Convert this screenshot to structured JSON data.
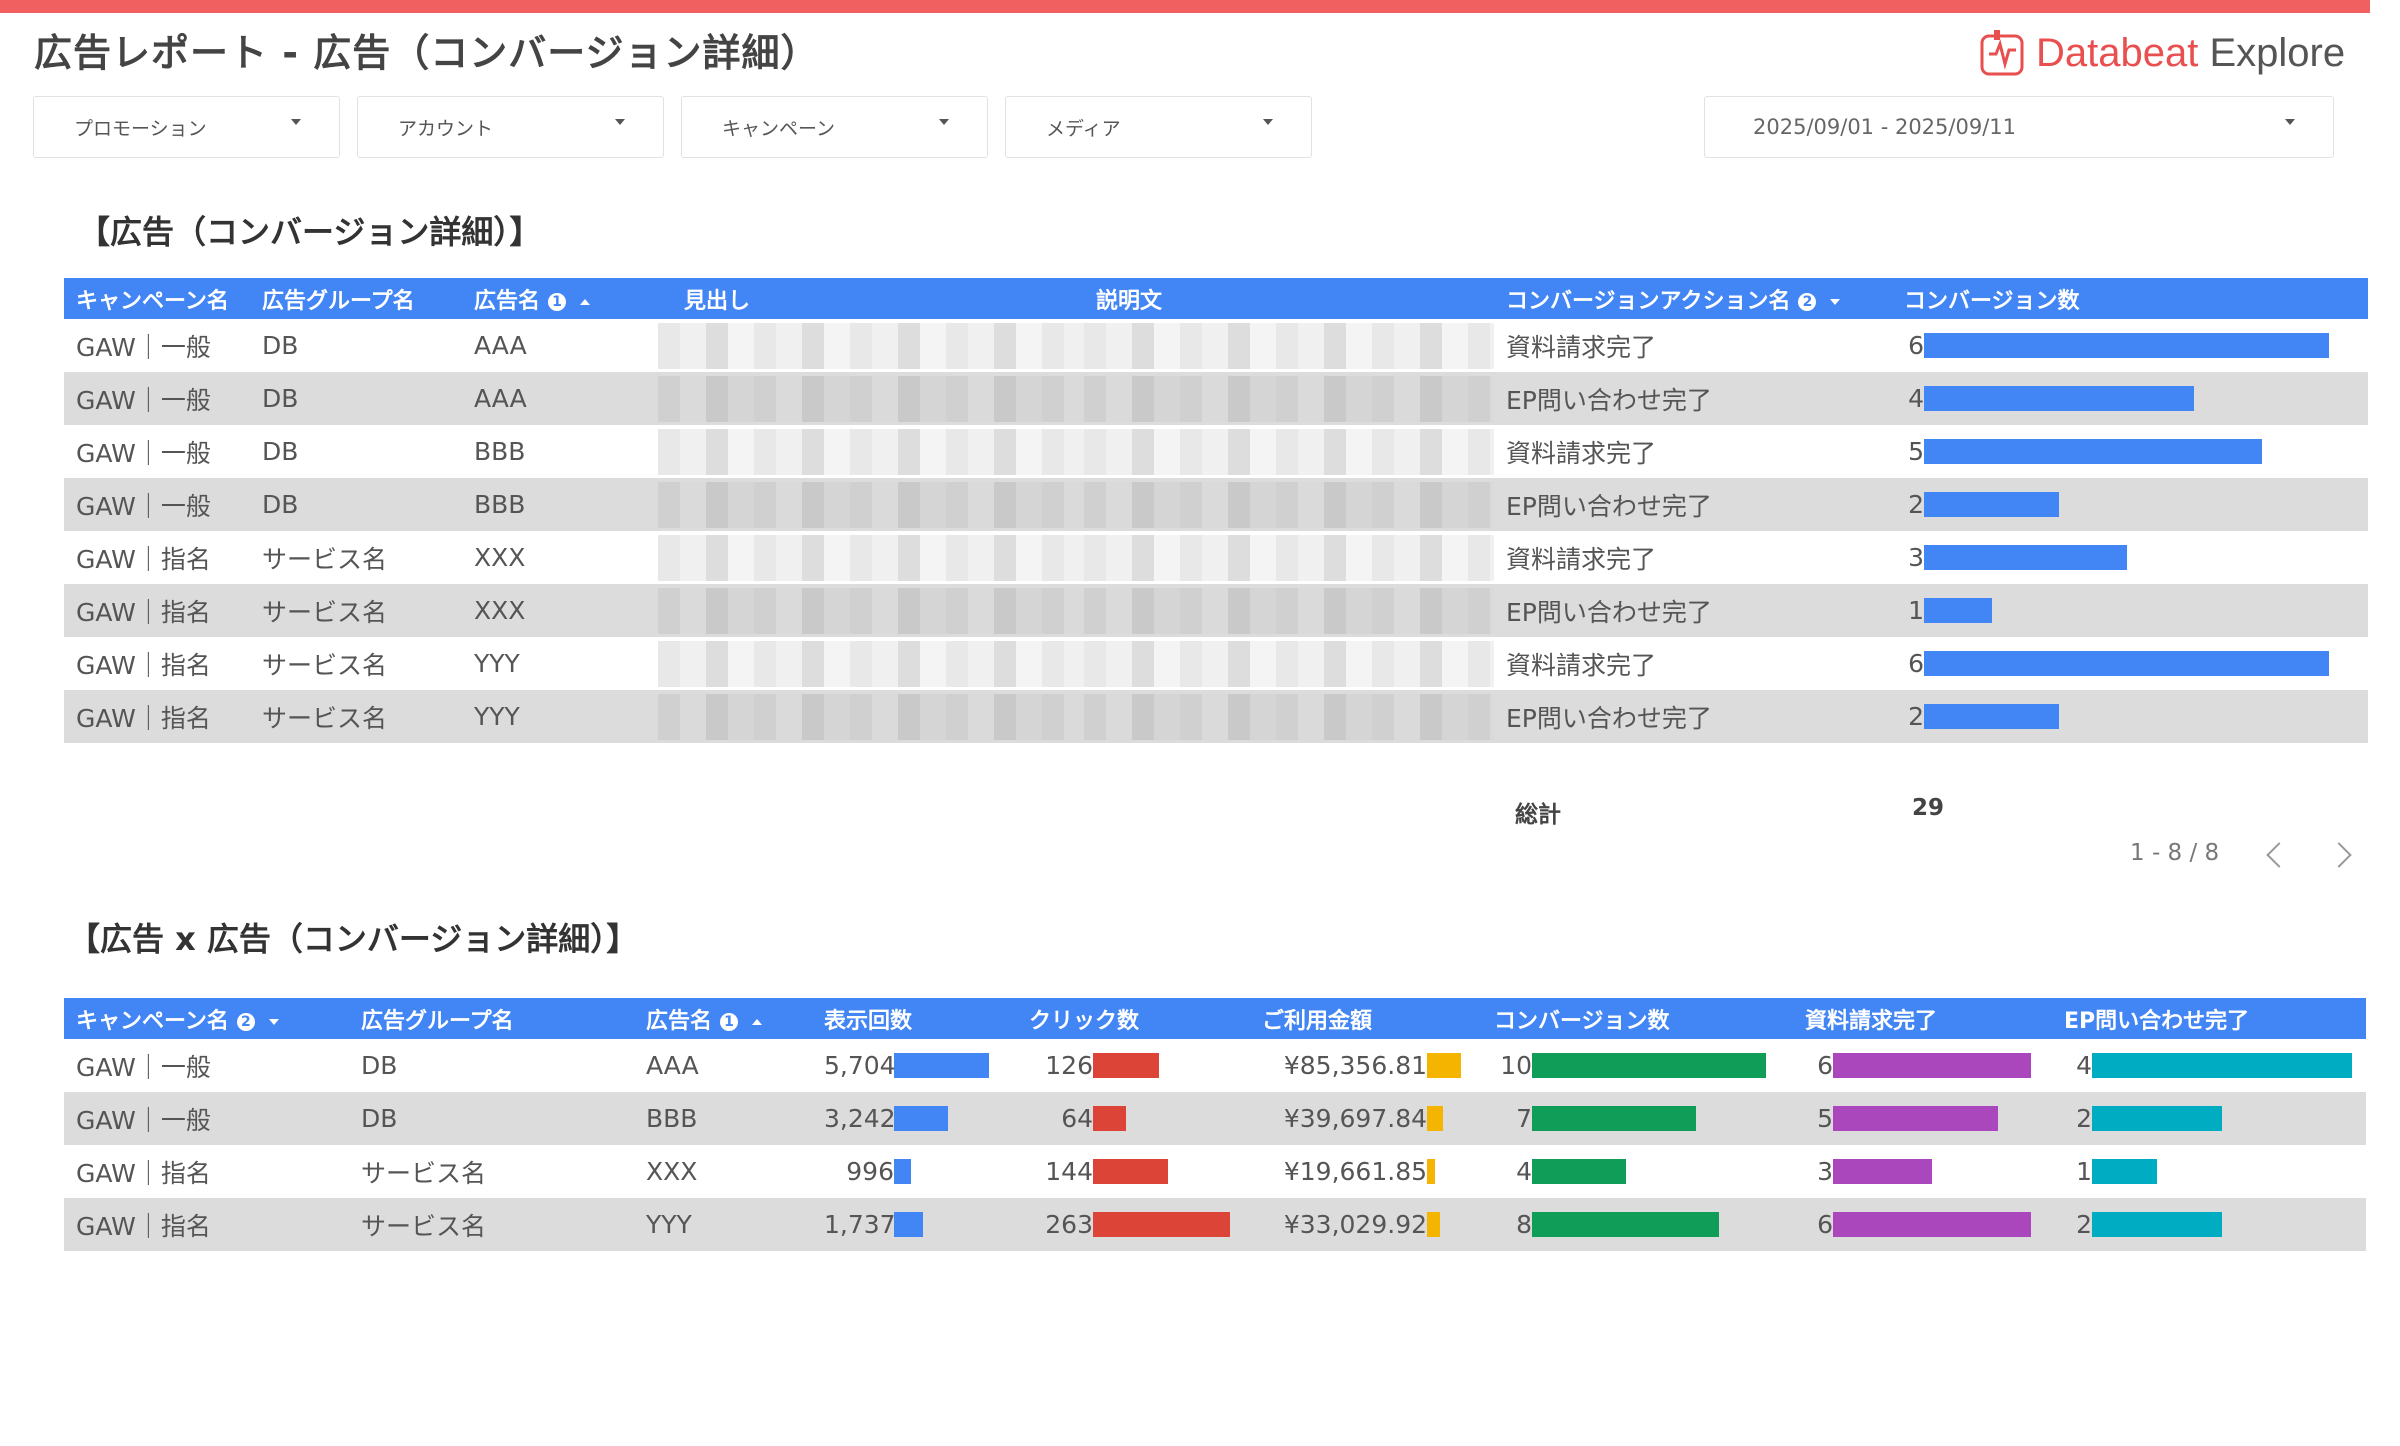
{
  "page_title": "広告レポート - 広告（コンバージョン詳細）",
  "brand": {
    "name": "Databeat",
    "suffix": " Explore",
    "color": "#e94f4f"
  },
  "filters": {
    "promotion": "プロモーション",
    "account": "アカウント",
    "campaign": "キャンペーン",
    "media": "メディア",
    "date_range": "2025/09/01 - 2025/09/11"
  },
  "table1": {
    "title": "【広告（コンバージョン詳細）】",
    "headers": [
      "キャンペーン名",
      "広告グループ名",
      "広告名",
      "見出し",
      "説明文",
      "コンバージョンアクション名",
      "コンバージョン数"
    ],
    "sort_badge_ad": "1",
    "sort_badge_action": "2",
    "max_value": 6,
    "rows": [
      {
        "campaign": "GAW｜一般",
        "adgroup": "DB",
        "ad": "AAA",
        "action": "資料請求完了",
        "conversions": 6
      },
      {
        "campaign": "GAW｜一般",
        "adgroup": "DB",
        "ad": "AAA",
        "action": "EP問い合わせ完了",
        "conversions": 4
      },
      {
        "campaign": "GAW｜一般",
        "adgroup": "DB",
        "ad": "BBB",
        "action": "資料請求完了",
        "conversions": 5
      },
      {
        "campaign": "GAW｜一般",
        "adgroup": "DB",
        "ad": "BBB",
        "action": "EP問い合わせ完了",
        "conversions": 2
      },
      {
        "campaign": "GAW｜指名",
        "adgroup": "サービス名",
        "ad": "XXX",
        "action": "資料請求完了",
        "conversions": 3
      },
      {
        "campaign": "GAW｜指名",
        "adgroup": "サービス名",
        "ad": "XXX",
        "action": "EP問い合わせ完了",
        "conversions": 1
      },
      {
        "campaign": "GAW｜指名",
        "adgroup": "サービス名",
        "ad": "YYY",
        "action": "資料請求完了",
        "conversions": 6
      },
      {
        "campaign": "GAW｜指名",
        "adgroup": "サービス名",
        "ad": "YYY",
        "action": "EP問い合わせ完了",
        "conversions": 2
      }
    ],
    "total_label": "総計",
    "total_value": "29",
    "pager": "1 - 8 / 8",
    "bar_color": "#4285f4"
  },
  "table2": {
    "title": "【広告 x 広告（コンバージョン詳細）】",
    "headers": [
      "キャンペーン名",
      "広告グループ名",
      "広告名",
      "表示回数",
      "クリック数",
      "ご利用金額",
      "コンバージョン数",
      "資料請求完了",
      "EP問い合わせ完了"
    ],
    "sort_badge_campaign": "2",
    "sort_badge_ad": "1",
    "colors": {
      "impressions": "#4285f4",
      "clicks": "#db4437",
      "cost": "#f4b400",
      "conversions": "#0f9d58",
      "request": "#ab47bc",
      "inquiry": "#00acc1"
    },
    "max": {
      "impressions": 5704,
      "clicks": 263,
      "cost": 85356.81,
      "conversions": 10,
      "request": 6,
      "inquiry": 4
    },
    "rows": [
      {
        "campaign": "GAW｜一般",
        "adgroup": "DB",
        "ad": "AAA",
        "impressions": 5704,
        "impressions_label": "5,704",
        "clicks": 126,
        "clicks_label": "126",
        "cost": 85356.81,
        "cost_label": "¥85,356.81",
        "conversions": 10,
        "conversions_label": "10",
        "request": 6,
        "request_label": "6",
        "inquiry": 4,
        "inquiry_label": "4"
      },
      {
        "campaign": "GAW｜一般",
        "adgroup": "DB",
        "ad": "BBB",
        "impressions": 3242,
        "impressions_label": "3,242",
        "clicks": 64,
        "clicks_label": "64",
        "cost": 39697.84,
        "cost_label": "¥39,697.84",
        "conversions": 7,
        "conversions_label": "7",
        "request": 5,
        "request_label": "5",
        "inquiry": 2,
        "inquiry_label": "2"
      },
      {
        "campaign": "GAW｜指名",
        "adgroup": "サービス名",
        "ad": "XXX",
        "impressions": 996,
        "impressions_label": "996",
        "clicks": 144,
        "clicks_label": "144",
        "cost": 19661.85,
        "cost_label": "¥19,661.85",
        "conversions": 4,
        "conversions_label": "4",
        "request": 3,
        "request_label": "3",
        "inquiry": 1,
        "inquiry_label": "1"
      },
      {
        "campaign": "GAW｜指名",
        "adgroup": "サービス名",
        "ad": "YYY",
        "impressions": 1737,
        "impressions_label": "1,737",
        "clicks": 263,
        "clicks_label": "263",
        "cost": 33029.92,
        "cost_label": "¥33,029.92",
        "conversions": 8,
        "conversions_label": "8",
        "request": 6,
        "request_label": "6",
        "inquiry": 2,
        "inquiry_label": "2"
      }
    ]
  }
}
